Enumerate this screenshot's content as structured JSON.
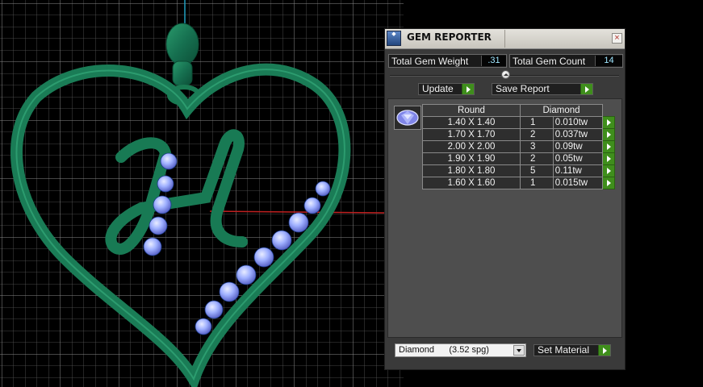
{
  "panel": {
    "title": "GEM REPORTER",
    "close_glyph": "×",
    "title_logo_icon": "gem-reporter-logo-icon"
  },
  "summary": {
    "total_weight_label": "Total Gem Weight",
    "total_weight_value": ".31",
    "total_count_label": "Total Gem Count",
    "total_count_value": "14"
  },
  "toolbar": {
    "update_label": "Update",
    "save_report_label": "Save Report"
  },
  "report": {
    "shape_header": "Round",
    "material_header": "Diamond",
    "gem_icon": "round-diamond-gem-icon",
    "rows": [
      {
        "size": "1.40 X 1.40",
        "count": "1",
        "weight": "0.010tw"
      },
      {
        "size": "1.70 X 1.70",
        "count": "2",
        "weight": "0.037tw"
      },
      {
        "size": "2.00 X 2.00",
        "count": "3",
        "weight": "0.09tw"
      },
      {
        "size": "1.90 X 1.90",
        "count": "2",
        "weight": "0.05tw"
      },
      {
        "size": "1.80 X 1.80",
        "count": "5",
        "weight": "0.11tw"
      },
      {
        "size": "1.60 X 1.60",
        "count": "1",
        "weight": "0.015tw"
      }
    ]
  },
  "material": {
    "selected": "Diamond      (3.52 spg)",
    "set_label": "Set Material"
  },
  "colors": {
    "metal": "#1d7a55",
    "gem": "#a9b8ff",
    "accent_green": "#3f8e1c"
  }
}
